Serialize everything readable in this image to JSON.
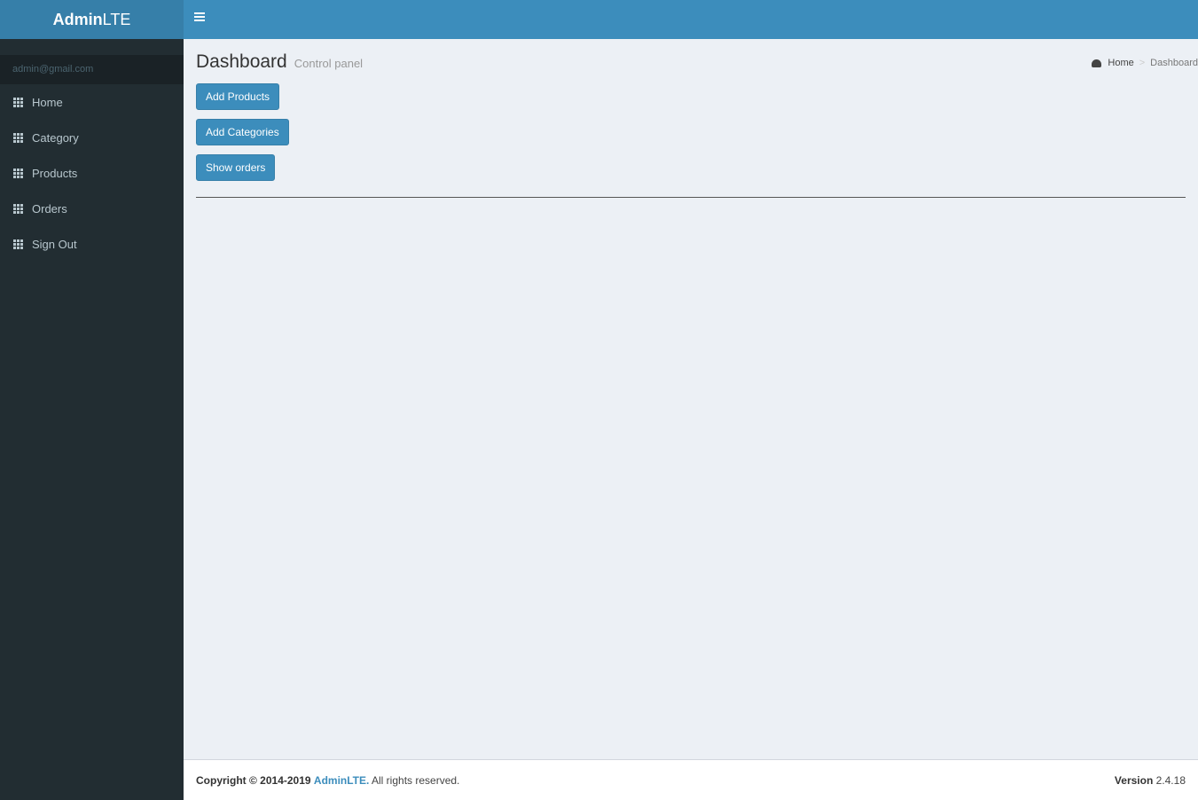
{
  "app": {
    "logo_bold": "Admin",
    "logo_light": "LTE"
  },
  "sidebar": {
    "user_email": "admin@gmail.com",
    "items": [
      {
        "label": "Home",
        "icon": "th-grid-icon"
      },
      {
        "label": "Category",
        "icon": "th-grid-icon"
      },
      {
        "label": "Products",
        "icon": "th-grid-icon"
      },
      {
        "label": "Orders",
        "icon": "th-grid-icon"
      },
      {
        "label": "Sign Out",
        "icon": "th-grid-icon"
      }
    ]
  },
  "header": {
    "title": "Dashboard",
    "subtitle": "Control panel"
  },
  "breadcrumb": {
    "home": "Home",
    "separator": ">",
    "current": "Dashboard"
  },
  "actions": {
    "add_products": "Add Products",
    "add_categories": "Add Categories",
    "show_orders": "Show orders"
  },
  "footer": {
    "copyright": "Copyright © 2014-2019",
    "brand": "AdminLTE.",
    "rights": "All rights reserved.",
    "version_label": "Version",
    "version": "2.4.18"
  },
  "colors": {
    "primary": "#3c8dbc",
    "logo_bg": "#367fa9",
    "sidebar_bg": "#222d32"
  }
}
